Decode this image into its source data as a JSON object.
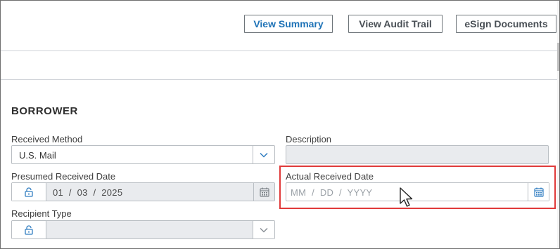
{
  "toolbar": {
    "view_summary": "View Summary",
    "view_audit_trail": "View Audit Trail",
    "esign_documents": "eSign Documents"
  },
  "section": {
    "title": "BORROWER"
  },
  "fields": {
    "received_method": {
      "label": "Received Method",
      "value": "U.S. Mail"
    },
    "description": {
      "label": "Description",
      "value": ""
    },
    "presumed_received_date": {
      "label": "Presumed Received Date",
      "value": "01  /  03  /  2025"
    },
    "actual_received_date": {
      "label": "Actual Received Date",
      "placeholder": "MM  /  DD  /  YYYY"
    },
    "recipient_type": {
      "label": "Recipient Type",
      "value": ""
    }
  },
  "colors": {
    "accent": "#1f73b7",
    "highlight": "#e03a3a",
    "disabled_bg": "#e9ebee"
  },
  "icons": {
    "dropdown": "chevron-down-icon",
    "lock": "unlock-icon",
    "calendar": "calendar-icon"
  }
}
